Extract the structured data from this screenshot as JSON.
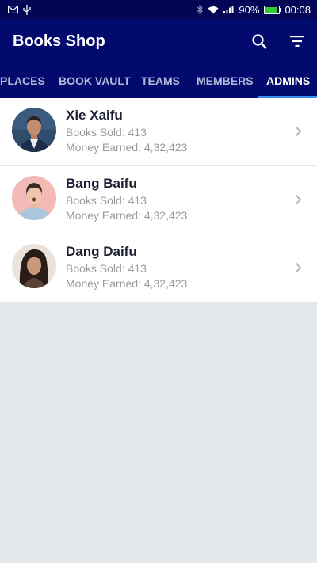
{
  "status_bar": {
    "battery_text": "90%",
    "battery_level": 0.9,
    "time": "00:08",
    "icons": [
      "gmail-icon",
      "usb-icon",
      "bluetooth-icon",
      "wifi-icon",
      "signal-icon",
      "battery-icon"
    ]
  },
  "app_bar": {
    "title": "Books Shop",
    "actions": [
      "search-icon",
      "filter-icon"
    ]
  },
  "tabs": [
    {
      "label": "PLACES",
      "active": false
    },
    {
      "label": "BOOK VAULT",
      "active": false
    },
    {
      "label": "TEAMS",
      "active": false
    },
    {
      "label": "MEMBERS",
      "active": false
    },
    {
      "label": "ADMINS",
      "active": true
    }
  ],
  "admins": [
    {
      "name": "Xie Xaifu",
      "books_sold": "Books Sold: 413",
      "money_earned": "Money Earned: 4,32,423"
    },
    {
      "name": "Bang Baifu",
      "books_sold": "Books Sold: 413",
      "money_earned": "Money Earned: 4,32,423"
    },
    {
      "name": "Dang Daifu",
      "books_sold": "Books Sold: 413",
      "money_earned": "Money Earned: 4,32,423"
    }
  ],
  "colors": {
    "status_bar": "#020655",
    "app_bar": "#020a6e",
    "tab_indicator": "#3c8df5",
    "background": "#e4e8ec"
  }
}
